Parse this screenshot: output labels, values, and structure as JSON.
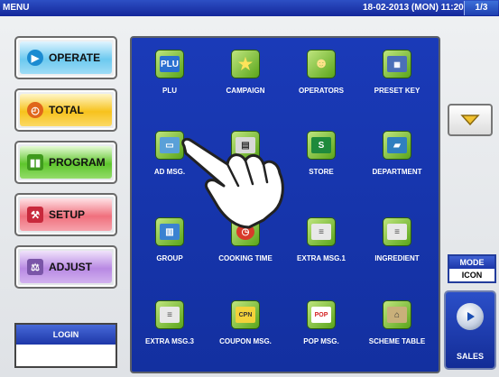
{
  "titlebar": {
    "title": "MENU",
    "datetime": "18-02-2013 (MON)  11:20",
    "page": "1/3"
  },
  "modes": [
    {
      "label": "OPERATE",
      "icon": "play-icon"
    },
    {
      "label": "TOTAL",
      "icon": "clock-icon"
    },
    {
      "label": "PROGRAM",
      "icon": "book-icon"
    },
    {
      "label": "SETUP",
      "icon": "wrench-icon"
    },
    {
      "label": "ADJUST",
      "icon": "scale-icon"
    }
  ],
  "login": {
    "label": "LOGIN",
    "value": ""
  },
  "menu_items": [
    {
      "label": "PLU",
      "icon": "plu-icon"
    },
    {
      "label": "CAMPAIGN",
      "icon": "star-icon"
    },
    {
      "label": "OPERATORS",
      "icon": "person-icon"
    },
    {
      "label": "PRESET KEY",
      "icon": "keyboard-icon"
    },
    {
      "label": "AD MSG.",
      "icon": "monitor-icon"
    },
    {
      "label": "ER",
      "icon": "printer-icon"
    },
    {
      "label": "STORE",
      "icon": "store-icon"
    },
    {
      "label": "DEPARTMENT",
      "icon": "folder-icon"
    },
    {
      "label": "GROUP",
      "icon": "group-icon"
    },
    {
      "label": "COOKING TIME",
      "icon": "timer-icon"
    },
    {
      "label": "EXTRA MSG.1",
      "icon": "message-icon"
    },
    {
      "label": "INGREDIENT",
      "icon": "message-icon"
    },
    {
      "label": "EXTRA MSG.3",
      "icon": "message-icon"
    },
    {
      "label": "COUPON MSG.",
      "icon": "coupon-icon"
    },
    {
      "label": "POP MSG.",
      "icon": "pop-icon"
    },
    {
      "label": "SCHEME TABLE",
      "icon": "scheme-icon"
    }
  ],
  "mode_status": {
    "label": "MODE",
    "value": "ICON"
  },
  "sales": {
    "label": "SALES"
  },
  "colors": {
    "titlebar": "#14279a",
    "panel": "#1a3ab8",
    "icon_green": "#5aa51a"
  }
}
